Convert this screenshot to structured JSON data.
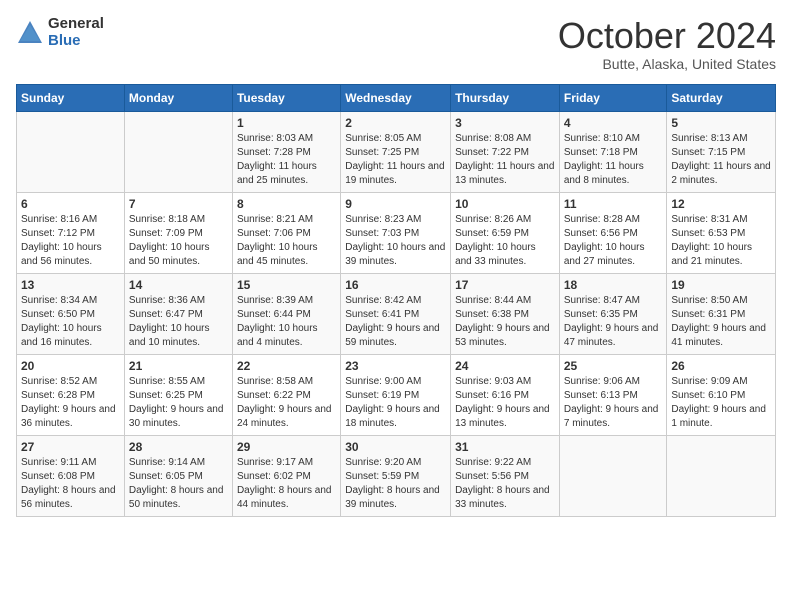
{
  "logo": {
    "general": "General",
    "blue": "Blue"
  },
  "title": "October 2024",
  "subtitle": "Butte, Alaska, United States",
  "headers": [
    "Sunday",
    "Monday",
    "Tuesday",
    "Wednesday",
    "Thursday",
    "Friday",
    "Saturday"
  ],
  "weeks": [
    [
      {
        "num": "",
        "sunrise": "",
        "sunset": "",
        "daylight": ""
      },
      {
        "num": "",
        "sunrise": "",
        "sunset": "",
        "daylight": ""
      },
      {
        "num": "1",
        "sunrise": "Sunrise: 8:03 AM",
        "sunset": "Sunset: 7:28 PM",
        "daylight": "Daylight: 11 hours and 25 minutes."
      },
      {
        "num": "2",
        "sunrise": "Sunrise: 8:05 AM",
        "sunset": "Sunset: 7:25 PM",
        "daylight": "Daylight: 11 hours and 19 minutes."
      },
      {
        "num": "3",
        "sunrise": "Sunrise: 8:08 AM",
        "sunset": "Sunset: 7:22 PM",
        "daylight": "Daylight: 11 hours and 13 minutes."
      },
      {
        "num": "4",
        "sunrise": "Sunrise: 8:10 AM",
        "sunset": "Sunset: 7:18 PM",
        "daylight": "Daylight: 11 hours and 8 minutes."
      },
      {
        "num": "5",
        "sunrise": "Sunrise: 8:13 AM",
        "sunset": "Sunset: 7:15 PM",
        "daylight": "Daylight: 11 hours and 2 minutes."
      }
    ],
    [
      {
        "num": "6",
        "sunrise": "Sunrise: 8:16 AM",
        "sunset": "Sunset: 7:12 PM",
        "daylight": "Daylight: 10 hours and 56 minutes."
      },
      {
        "num": "7",
        "sunrise": "Sunrise: 8:18 AM",
        "sunset": "Sunset: 7:09 PM",
        "daylight": "Daylight: 10 hours and 50 minutes."
      },
      {
        "num": "8",
        "sunrise": "Sunrise: 8:21 AM",
        "sunset": "Sunset: 7:06 PM",
        "daylight": "Daylight: 10 hours and 45 minutes."
      },
      {
        "num": "9",
        "sunrise": "Sunrise: 8:23 AM",
        "sunset": "Sunset: 7:03 PM",
        "daylight": "Daylight: 10 hours and 39 minutes."
      },
      {
        "num": "10",
        "sunrise": "Sunrise: 8:26 AM",
        "sunset": "Sunset: 6:59 PM",
        "daylight": "Daylight: 10 hours and 33 minutes."
      },
      {
        "num": "11",
        "sunrise": "Sunrise: 8:28 AM",
        "sunset": "Sunset: 6:56 PM",
        "daylight": "Daylight: 10 hours and 27 minutes."
      },
      {
        "num": "12",
        "sunrise": "Sunrise: 8:31 AM",
        "sunset": "Sunset: 6:53 PM",
        "daylight": "Daylight: 10 hours and 21 minutes."
      }
    ],
    [
      {
        "num": "13",
        "sunrise": "Sunrise: 8:34 AM",
        "sunset": "Sunset: 6:50 PM",
        "daylight": "Daylight: 10 hours and 16 minutes."
      },
      {
        "num": "14",
        "sunrise": "Sunrise: 8:36 AM",
        "sunset": "Sunset: 6:47 PM",
        "daylight": "Daylight: 10 hours and 10 minutes."
      },
      {
        "num": "15",
        "sunrise": "Sunrise: 8:39 AM",
        "sunset": "Sunset: 6:44 PM",
        "daylight": "Daylight: 10 hours and 4 minutes."
      },
      {
        "num": "16",
        "sunrise": "Sunrise: 8:42 AM",
        "sunset": "Sunset: 6:41 PM",
        "daylight": "Daylight: 9 hours and 59 minutes."
      },
      {
        "num": "17",
        "sunrise": "Sunrise: 8:44 AM",
        "sunset": "Sunset: 6:38 PM",
        "daylight": "Daylight: 9 hours and 53 minutes."
      },
      {
        "num": "18",
        "sunrise": "Sunrise: 8:47 AM",
        "sunset": "Sunset: 6:35 PM",
        "daylight": "Daylight: 9 hours and 47 minutes."
      },
      {
        "num": "19",
        "sunrise": "Sunrise: 8:50 AM",
        "sunset": "Sunset: 6:31 PM",
        "daylight": "Daylight: 9 hours and 41 minutes."
      }
    ],
    [
      {
        "num": "20",
        "sunrise": "Sunrise: 8:52 AM",
        "sunset": "Sunset: 6:28 PM",
        "daylight": "Daylight: 9 hours and 36 minutes."
      },
      {
        "num": "21",
        "sunrise": "Sunrise: 8:55 AM",
        "sunset": "Sunset: 6:25 PM",
        "daylight": "Daylight: 9 hours and 30 minutes."
      },
      {
        "num": "22",
        "sunrise": "Sunrise: 8:58 AM",
        "sunset": "Sunset: 6:22 PM",
        "daylight": "Daylight: 9 hours and 24 minutes."
      },
      {
        "num": "23",
        "sunrise": "Sunrise: 9:00 AM",
        "sunset": "Sunset: 6:19 PM",
        "daylight": "Daylight: 9 hours and 18 minutes."
      },
      {
        "num": "24",
        "sunrise": "Sunrise: 9:03 AM",
        "sunset": "Sunset: 6:16 PM",
        "daylight": "Daylight: 9 hours and 13 minutes."
      },
      {
        "num": "25",
        "sunrise": "Sunrise: 9:06 AM",
        "sunset": "Sunset: 6:13 PM",
        "daylight": "Daylight: 9 hours and 7 minutes."
      },
      {
        "num": "26",
        "sunrise": "Sunrise: 9:09 AM",
        "sunset": "Sunset: 6:10 PM",
        "daylight": "Daylight: 9 hours and 1 minute."
      }
    ],
    [
      {
        "num": "27",
        "sunrise": "Sunrise: 9:11 AM",
        "sunset": "Sunset: 6:08 PM",
        "daylight": "Daylight: 8 hours and 56 minutes."
      },
      {
        "num": "28",
        "sunrise": "Sunrise: 9:14 AM",
        "sunset": "Sunset: 6:05 PM",
        "daylight": "Daylight: 8 hours and 50 minutes."
      },
      {
        "num": "29",
        "sunrise": "Sunrise: 9:17 AM",
        "sunset": "Sunset: 6:02 PM",
        "daylight": "Daylight: 8 hours and 44 minutes."
      },
      {
        "num": "30",
        "sunrise": "Sunrise: 9:20 AM",
        "sunset": "Sunset: 5:59 PM",
        "daylight": "Daylight: 8 hours and 39 minutes."
      },
      {
        "num": "31",
        "sunrise": "Sunrise: 9:22 AM",
        "sunset": "Sunset: 5:56 PM",
        "daylight": "Daylight: 8 hours and 33 minutes."
      },
      {
        "num": "",
        "sunrise": "",
        "sunset": "",
        "daylight": ""
      },
      {
        "num": "",
        "sunrise": "",
        "sunset": "",
        "daylight": ""
      }
    ]
  ]
}
